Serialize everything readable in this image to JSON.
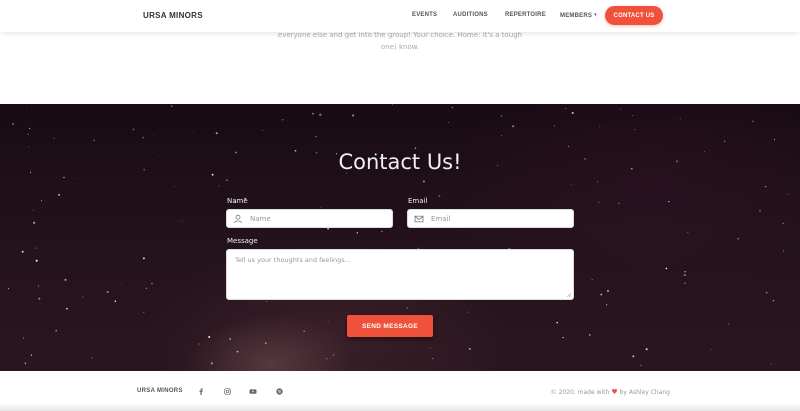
{
  "navbar": {
    "brand": "URSA MINORS",
    "links": [
      "EVENTS",
      "AUDITIONS",
      "REPERTOIRE",
      "MEMBERS"
    ],
    "members_caret": "▾",
    "contact_button": "CONTACT US"
  },
  "intro": {
    "line1": "everyone else and get into the group! Your choice. Home: it's a tough",
    "line2": "one) know."
  },
  "contact": {
    "title": "Contact Us!",
    "name_label": "Name",
    "name_placeholder": "Name",
    "email_label": "Email",
    "email_placeholder": "Email",
    "message_label": "Message",
    "message_placeholder": "Tell us your thoughts and feelings...",
    "send_button": "SEND MESSAGE"
  },
  "footer": {
    "brand": "URSA MINORS",
    "social_icons": [
      "facebook-icon",
      "instagram-icon",
      "youtube-icon",
      "spotify-icon"
    ],
    "credit_prefix": "© 2020, made with",
    "heart": "♥",
    "credit_suffix": "by Ashley Chang"
  },
  "colors": {
    "accent": "#f0513a",
    "section_bg": "#1f0f19"
  }
}
